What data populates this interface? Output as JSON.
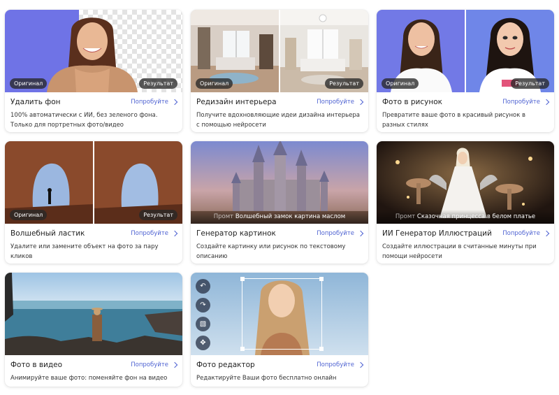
{
  "labels": {
    "original": "Оригинал",
    "result": "Результат",
    "prompt": "Промт"
  },
  "cards": [
    {
      "title": "Удалить фон",
      "try": "Попробуйте",
      "desc": "100% автоматически с ИИ, без зеленого фона. Только для портретных фото/видео"
    },
    {
      "title": "Редизайн интерьера",
      "try": "Попробуйте",
      "desc": "Получите вдохновляющие идеи дизайна интерьера с помощью нейросети"
    },
    {
      "title": "Фото в рисунок",
      "try": "Попробуйте",
      "desc": "Превратите ваше фото в красивый рисунок в разных стилях"
    },
    {
      "title": "Волшебный ластик",
      "try": "Попробуйте",
      "desc": "Удалите или замените объект на фото за пару кликов"
    },
    {
      "title": "Генератор картинок",
      "try": "Попробуйте",
      "desc": "Создайте картинку или рисунок по текстовому описанию",
      "prompt_text": "Волшебный замок картина маслом"
    },
    {
      "title": "ИИ Генератор Иллюстраций",
      "try": "Попробуйте",
      "desc": "Создайте иллюстрации в считанные минуты при помощи нейросети",
      "prompt_text": "Сказочная принцесса в белом платье"
    },
    {
      "title": "Фото в видео",
      "try": "Попробуйте",
      "desc": "Анимируйте ваше фото: поменяйте фон на видео"
    },
    {
      "title": "Фото редактор",
      "try": "Попробуйте",
      "desc": "Редактируйте Ваши фото бесплатно онлайн"
    }
  ],
  "editor_tools": [
    "undo-icon",
    "redo-icon",
    "image-icon",
    "move-icon"
  ],
  "colors": {
    "link": "#4f63d2",
    "pill_bg": "#282828",
    "card_bg": "#ffffff"
  }
}
